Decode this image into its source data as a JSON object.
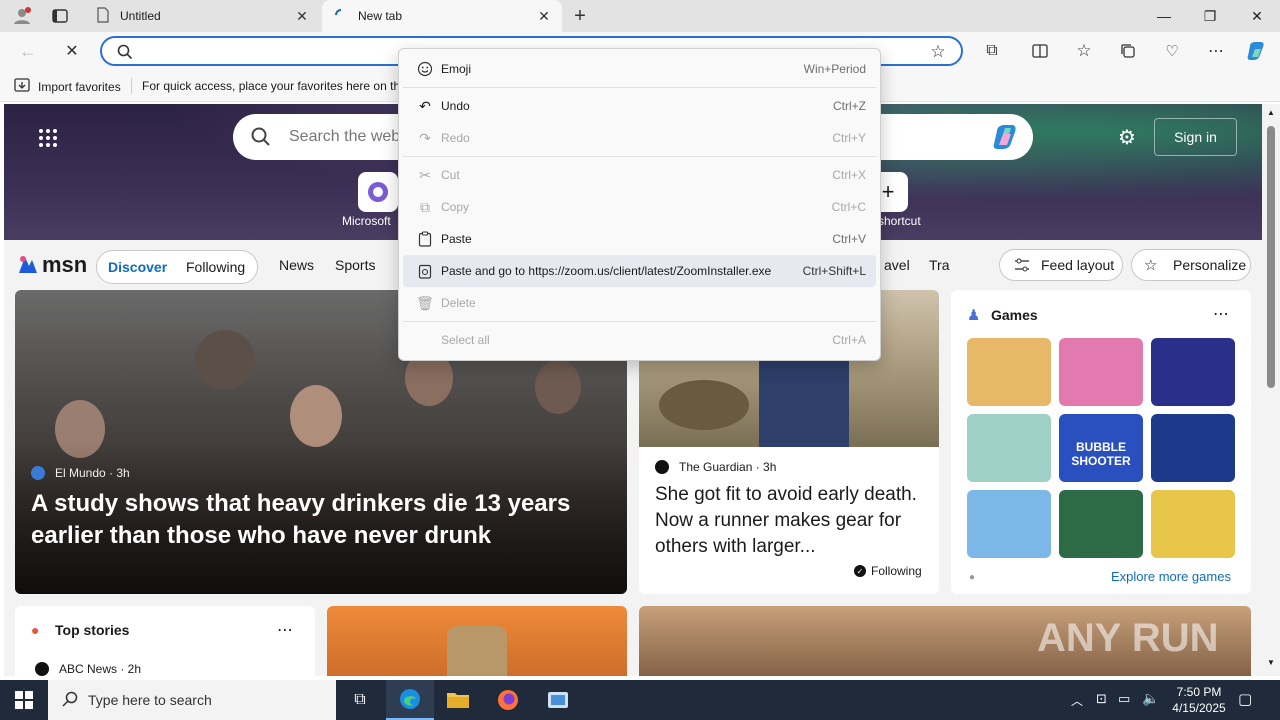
{
  "browser": {
    "tabs": [
      {
        "title": "Untitled",
        "active": false
      },
      {
        "title": "New tab",
        "active": true
      }
    ],
    "address": {
      "value": "",
      "placeholder": ""
    },
    "favorites_bar": {
      "import_label": "Import favorites",
      "hint": "For quick access, place your favorites here on the"
    }
  },
  "context_menu": {
    "items": [
      {
        "label": "Emoji",
        "shortcut": "Win+Period",
        "icon": "emoji-icon",
        "enabled": true
      },
      {
        "label": "Undo",
        "shortcut": "Ctrl+Z",
        "icon": "undo-icon",
        "enabled": true
      },
      {
        "label": "Redo",
        "shortcut": "Ctrl+Y",
        "icon": "redo-icon",
        "enabled": false
      },
      {
        "label": "Cut",
        "shortcut": "Ctrl+X",
        "icon": "cut-icon",
        "enabled": false
      },
      {
        "label": "Copy",
        "shortcut": "Ctrl+C",
        "icon": "copy-icon",
        "enabled": false
      },
      {
        "label": "Paste",
        "shortcut": "Ctrl+V",
        "icon": "paste-icon",
        "enabled": true
      },
      {
        "label": "Paste and go to https://zoom.us/client/latest/ZoomInstaller.exe",
        "shortcut": "Ctrl+Shift+L",
        "icon": "paste-go-icon",
        "enabled": true,
        "highlighted": true
      },
      {
        "label": "Delete",
        "shortcut": "",
        "icon": "delete-icon",
        "enabled": false
      },
      {
        "label": "Select all",
        "shortcut": "Ctrl+A",
        "icon": "",
        "enabled": false
      }
    ]
  },
  "msn": {
    "search_placeholder": "Search the web",
    "sign_in": "Sign in",
    "shortcuts": [
      {
        "label": "Microsoft"
      },
      {
        "label": "shortcut"
      }
    ],
    "logo": "msn",
    "nav": {
      "discover": "Discover",
      "following": "Following",
      "links": [
        "News",
        "Sports",
        "avel",
        "Tra"
      ],
      "feed_layout": "Feed layout",
      "personalize": "Personalize"
    },
    "hero": {
      "source": "El Mundo · 3h",
      "headline": "A study shows that heavy drinkers die 13 years earlier than those who have never drunk"
    },
    "story2": {
      "source": "The Guardian · 3h",
      "headline": "She got fit to avoid early death. Now a runner makes gear for others with larger...",
      "following": "Following"
    },
    "games": {
      "title": "Games",
      "explore": "Explore more games",
      "tile_text": "BUBBLE SHOOTER"
    },
    "top_stories": {
      "title": "Top stories",
      "first_source": "ABC News · 2h"
    },
    "watermark": "ANY RUN"
  },
  "taskbar": {
    "search_placeholder": "Type here to search",
    "time": "7:50 PM",
    "date": "4/15/2025"
  },
  "colors": {
    "accent": "#2b6fd6",
    "msn_blue": "#0f6cbd",
    "taskbar": "#1f2a3a"
  }
}
